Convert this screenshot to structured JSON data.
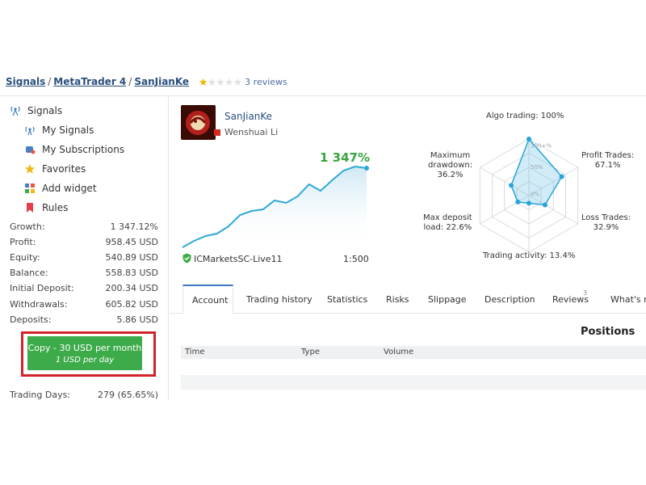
{
  "breadcrumb": {
    "signals": "Signals",
    "sep1": "/",
    "platform": "MetaTrader 4",
    "sep2": "/",
    "name": "SanJianKe",
    "rating_stars": 1,
    "rating_max": 5,
    "reviews": "3 reviews"
  },
  "sidebar": {
    "items": [
      {
        "label": "Signals",
        "icon": "antenna-icon"
      },
      {
        "label": "My Signals",
        "icon": "broadcast-icon"
      },
      {
        "label": "My Subscriptions",
        "icon": "subscriptions-icon"
      },
      {
        "label": "Favorites",
        "icon": "star-icon"
      },
      {
        "label": "Add widget",
        "icon": "widget-icon"
      },
      {
        "label": "Rules",
        "icon": "bookmark-icon"
      }
    ],
    "stats": [
      {
        "label": "Growth:",
        "value": "1 347.12%"
      },
      {
        "label": "Profit:",
        "value": "958.45 USD"
      },
      {
        "label": "Equity:",
        "value": "540.89 USD"
      },
      {
        "label": "Balance:",
        "value": "558.83 USD"
      },
      {
        "label": "Initial Deposit:",
        "value": "200.34 USD"
      },
      {
        "label": "Withdrawals:",
        "value": "605.82 USD"
      },
      {
        "label": "Deposits:",
        "value": "5.86 USD"
      }
    ],
    "copy_button": {
      "line1": "Copy - 30 USD per month",
      "line2": "1 USD per day"
    },
    "trading_days": {
      "label": "Trading Days:",
      "value": "279 (65.65%)"
    }
  },
  "profile": {
    "name": "SanJianKe",
    "author": "Wenshuai Li",
    "growth": "1 347%",
    "broker": "ICMarketsSC-Live11",
    "leverage": "1:500"
  },
  "growth_chart": {
    "type": "area",
    "values": [
      0,
      8,
      14,
      17,
      26,
      40,
      45,
      47,
      58,
      55,
      63,
      78,
      70,
      83,
      95,
      100,
      98
    ]
  },
  "radar": {
    "ticks": [
      "100+%",
      "50%",
      "0%"
    ],
    "axes": [
      {
        "label": "Algo trading: 100%",
        "value": 100
      },
      {
        "label": "Profit Trades:\n67.1%",
        "value": 67.1
      },
      {
        "label": "Loss Trades:\n32.9%",
        "value": 32.9
      },
      {
        "label": "Trading activity: 13.4%",
        "value": 13.4
      },
      {
        "label": "Max deposit\nload: 22.6%",
        "value": 22.6
      },
      {
        "label": "Maximum\ndrawdown:\n36.2%",
        "value": 36.2
      }
    ]
  },
  "tabs": [
    {
      "label": "Account",
      "active": true
    },
    {
      "label": "Trading history"
    },
    {
      "label": "Statistics"
    },
    {
      "label": "Risks"
    },
    {
      "label": "Slippage"
    },
    {
      "label": "Description"
    },
    {
      "label": "Reviews",
      "badge": "3"
    },
    {
      "label": "What's ne"
    }
  ],
  "positions": {
    "title": "Positions",
    "columns": [
      "Time",
      "Type",
      "Volume"
    ]
  },
  "colors": {
    "accent": "#3a78c2",
    "growth": "#3ba43f",
    "copy": "#3dab4a",
    "highlight": "#d2232a",
    "chart_line": "#2fa8d8"
  }
}
